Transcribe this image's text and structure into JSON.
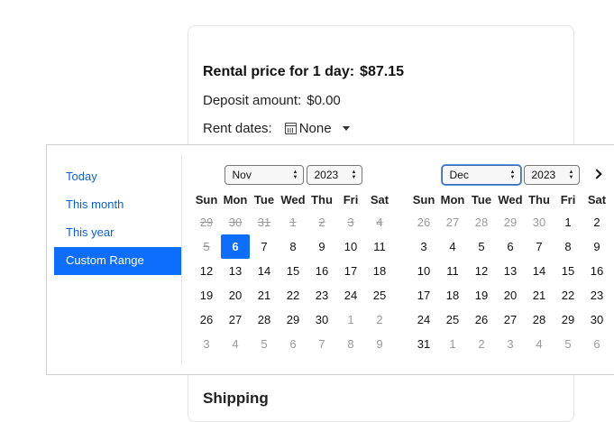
{
  "rental": {
    "title": "Rental price for 1 day:",
    "price": "$87.15",
    "deposit_label": "Deposit amount:",
    "deposit_value": "$0.00",
    "dates_label": "Rent dates:",
    "dates_value": "None"
  },
  "shipping_title": "Shipping",
  "ranges": [
    "Today",
    "This month",
    "This year",
    "Custom Range"
  ],
  "active_range": "Custom Range",
  "weekdays": [
    "Sun",
    "Mon",
    "Tue",
    "Wed",
    "Thu",
    "Fri",
    "Sat"
  ],
  "months": [
    {
      "month": "Nov",
      "year": "2023",
      "days": [
        {
          "d": "29",
          "s": "dis"
        },
        {
          "d": "30",
          "s": "dis"
        },
        {
          "d": "31",
          "s": "dis"
        },
        {
          "d": "1",
          "s": "dis"
        },
        {
          "d": "2",
          "s": "dis"
        },
        {
          "d": "3",
          "s": "dis"
        },
        {
          "d": "4",
          "s": "dis"
        },
        {
          "d": "5",
          "s": "dis"
        },
        {
          "d": "6",
          "s": "selected"
        },
        {
          "d": "7"
        },
        {
          "d": "8"
        },
        {
          "d": "9"
        },
        {
          "d": "10"
        },
        {
          "d": "11"
        },
        {
          "d": "12"
        },
        {
          "d": "13"
        },
        {
          "d": "14"
        },
        {
          "d": "15"
        },
        {
          "d": "16"
        },
        {
          "d": "17"
        },
        {
          "d": "18"
        },
        {
          "d": "19"
        },
        {
          "d": "20"
        },
        {
          "d": "21"
        },
        {
          "d": "22"
        },
        {
          "d": "23"
        },
        {
          "d": "24"
        },
        {
          "d": "25"
        },
        {
          "d": "26"
        },
        {
          "d": "27"
        },
        {
          "d": "28"
        },
        {
          "d": "29"
        },
        {
          "d": "30"
        },
        {
          "d": "1",
          "s": "off"
        },
        {
          "d": "2",
          "s": "off"
        },
        {
          "d": "3",
          "s": "off"
        },
        {
          "d": "4",
          "s": "off"
        },
        {
          "d": "5",
          "s": "off"
        },
        {
          "d": "6",
          "s": "off"
        },
        {
          "d": "7",
          "s": "off"
        },
        {
          "d": "8",
          "s": "off"
        },
        {
          "d": "9",
          "s": "off"
        }
      ]
    },
    {
      "month": "Dec",
      "year": "2023",
      "days": [
        {
          "d": "26",
          "s": "off"
        },
        {
          "d": "27",
          "s": "off"
        },
        {
          "d": "28",
          "s": "off"
        },
        {
          "d": "29",
          "s": "off"
        },
        {
          "d": "30",
          "s": "off"
        },
        {
          "d": "1"
        },
        {
          "d": "2"
        },
        {
          "d": "3"
        },
        {
          "d": "4"
        },
        {
          "d": "5"
        },
        {
          "d": "6"
        },
        {
          "d": "7"
        },
        {
          "d": "8"
        },
        {
          "d": "9"
        },
        {
          "d": "10"
        },
        {
          "d": "11"
        },
        {
          "d": "12"
        },
        {
          "d": "13"
        },
        {
          "d": "14"
        },
        {
          "d": "15"
        },
        {
          "d": "16"
        },
        {
          "d": "17"
        },
        {
          "d": "18"
        },
        {
          "d": "19"
        },
        {
          "d": "20"
        },
        {
          "d": "21"
        },
        {
          "d": "22"
        },
        {
          "d": "23"
        },
        {
          "d": "24"
        },
        {
          "d": "25"
        },
        {
          "d": "26"
        },
        {
          "d": "27"
        },
        {
          "d": "28"
        },
        {
          "d": "29"
        },
        {
          "d": "30"
        },
        {
          "d": "31"
        },
        {
          "d": "1",
          "s": "off"
        },
        {
          "d": "2",
          "s": "off"
        },
        {
          "d": "3",
          "s": "off"
        },
        {
          "d": "4",
          "s": "off"
        },
        {
          "d": "5",
          "s": "off"
        },
        {
          "d": "6",
          "s": "off"
        }
      ]
    }
  ],
  "icons": {
    "calendar": "calendar-icon",
    "next": "chevron-right-icon",
    "caret": "caret-down-icon"
  },
  "colors": {
    "accent": "#0d6efd",
    "link": "#0b5ed7"
  }
}
